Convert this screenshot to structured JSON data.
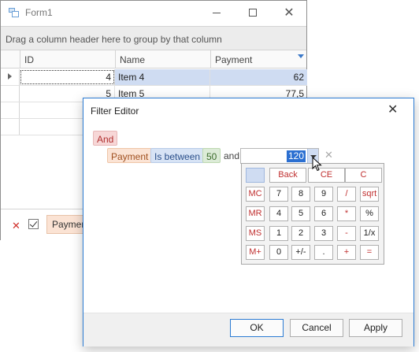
{
  "form": {
    "title": "Form1",
    "group_panel_text": "Drag a column header here to group by that column",
    "columns": [
      "ID",
      "Name",
      "Payment"
    ],
    "rows": [
      {
        "id": "4",
        "name": "Item 4",
        "payment": "62",
        "selected": true
      },
      {
        "id": "5",
        "name": "Item 5",
        "payment": "77,5"
      },
      {
        "id": "",
        "name": "",
        "payment": ""
      },
      {
        "id": "",
        "name": "",
        "payment": ""
      }
    ],
    "filter_panel_text": "Payment"
  },
  "dialog": {
    "title": "Filter Editor",
    "group_operator": "And",
    "condition": {
      "field": "Payment",
      "operator": "Is between",
      "value1": "50",
      "conjunction": "and",
      "value2": "120"
    },
    "calculator": {
      "buttons": [
        [
          "Back",
          "CE",
          "C"
        ],
        [
          "MC",
          "7",
          "8",
          "9",
          "/",
          "sqrt"
        ],
        [
          "MR",
          "4",
          "5",
          "6",
          "*",
          "%"
        ],
        [
          "MS",
          "1",
          "2",
          "3",
          "-",
          "1/x"
        ],
        [
          "M+",
          "0",
          "+/-",
          ".",
          "+",
          "="
        ]
      ]
    },
    "footer": {
      "ok": "OK",
      "cancel": "Cancel",
      "apply": "Apply"
    }
  },
  "colors": {
    "accent": "#2b7bd3",
    "selection": "#cfdcf2",
    "and_chip": "#f7d7d7",
    "field_chip": "#fbe3d4",
    "operator_chip": "#d7e3f5",
    "value_chip": "#dcebd7"
  }
}
